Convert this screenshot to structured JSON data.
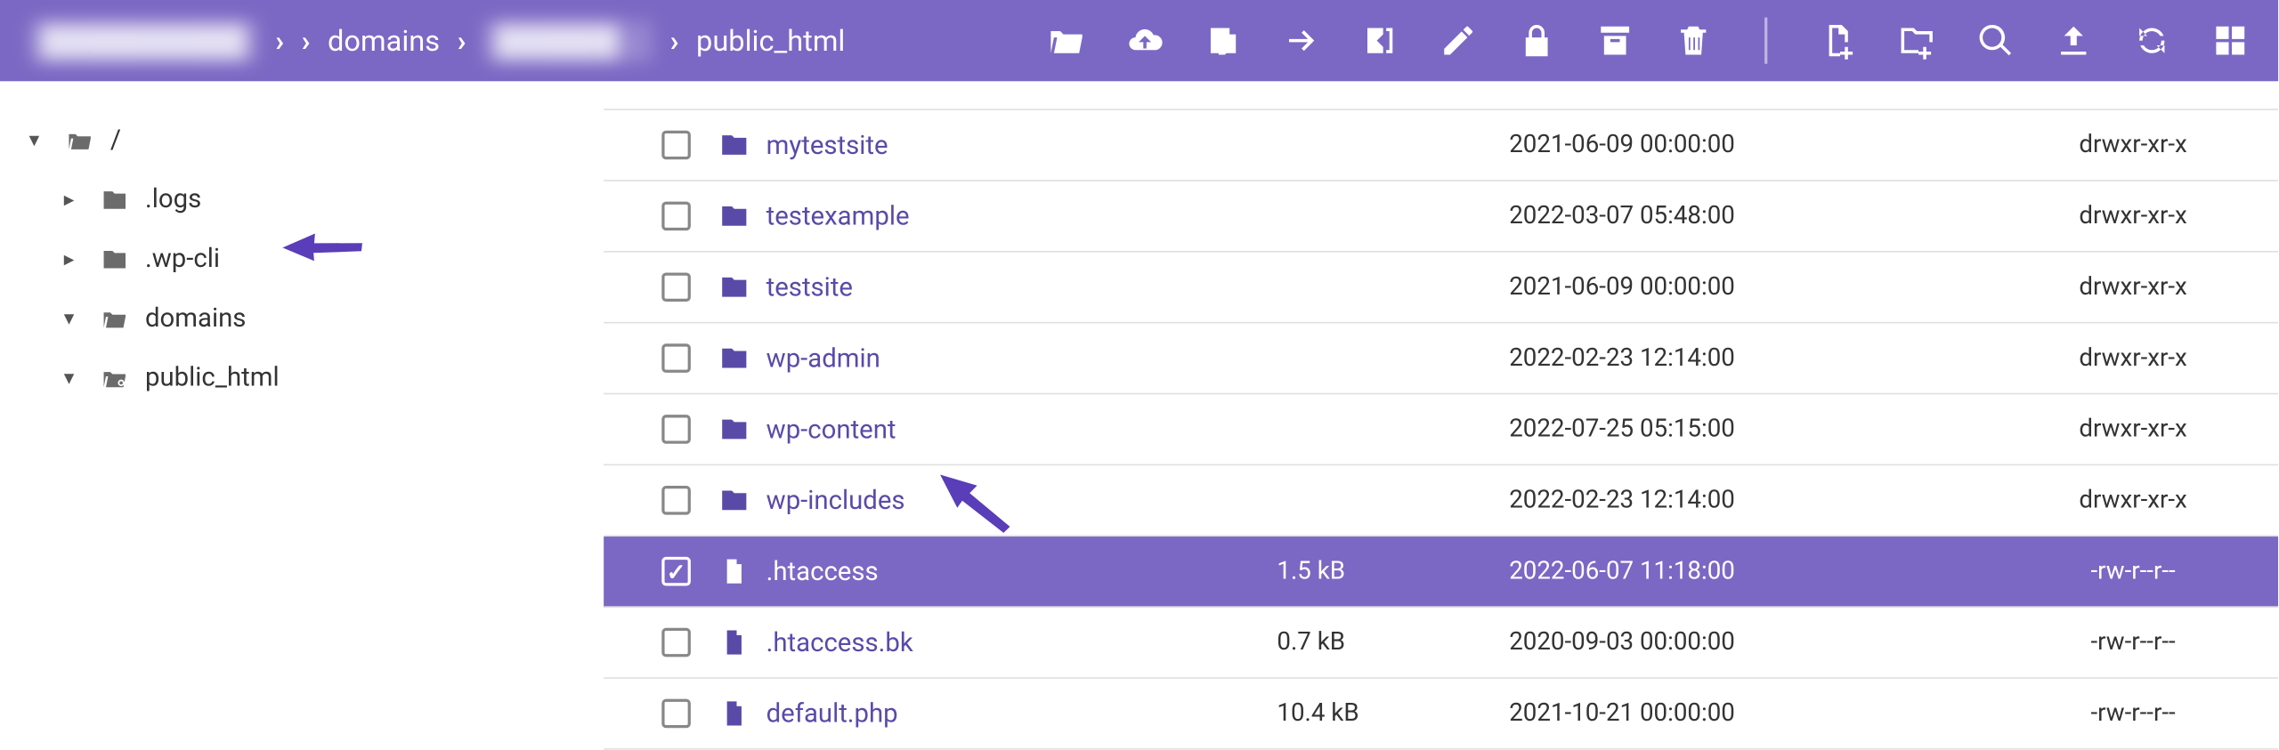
{
  "breadcrumb": {
    "host_blurred": "██████████",
    "items": [
      "domains",
      "██████ ..",
      "public_html"
    ]
  },
  "tree": [
    {
      "caret": "▾",
      "icon": "folder-open",
      "label": "/",
      "indent": 0
    },
    {
      "caret": "▸",
      "icon": "folder",
      "label": ".logs",
      "indent": 1
    },
    {
      "caret": "▸",
      "icon": "folder",
      "label": ".wp-cli",
      "indent": 1
    },
    {
      "caret": "▾",
      "icon": "folder-open",
      "label": "domains",
      "indent": 1
    },
    {
      "caret": "▾",
      "icon": "folder-link",
      "label": "public_html",
      "indent": 1,
      "annotated": true
    }
  ],
  "files": [
    {
      "type": "folder",
      "name": "mytestsite",
      "size": "",
      "date": "2021-06-09 00:00:00",
      "perm": "drwxr-xr-x",
      "selected": false
    },
    {
      "type": "folder",
      "name": "testexample",
      "size": "",
      "date": "2022-03-07 05:48:00",
      "perm": "drwxr-xr-x",
      "selected": false
    },
    {
      "type": "folder",
      "name": "testsite",
      "size": "",
      "date": "2021-06-09 00:00:00",
      "perm": "drwxr-xr-x",
      "selected": false
    },
    {
      "type": "folder",
      "name": "wp-admin",
      "size": "",
      "date": "2022-02-23 12:14:00",
      "perm": "drwxr-xr-x",
      "selected": false
    },
    {
      "type": "folder",
      "name": "wp-content",
      "size": "",
      "date": "2022-07-25 05:15:00",
      "perm": "drwxr-xr-x",
      "selected": false
    },
    {
      "type": "folder",
      "name": "wp-includes",
      "size": "",
      "date": "2022-02-23 12:14:00",
      "perm": "drwxr-xr-x",
      "selected": false,
      "annotated": true
    },
    {
      "type": "file",
      "name": ".htaccess",
      "size": "1.5 kB",
      "date": "2022-06-07 11:18:00",
      "perm": "-rw-r--r--",
      "selected": true
    },
    {
      "type": "file",
      "name": ".htaccess.bk",
      "size": "0.7 kB",
      "date": "2020-09-03 00:00:00",
      "perm": "-rw-r--r--",
      "selected": false
    },
    {
      "type": "file",
      "name": "default.php",
      "size": "10.4 kB",
      "date": "2021-10-21 00:00:00",
      "perm": "-rw-r--r--",
      "selected": false
    }
  ],
  "toolbar_icons": [
    "folder-open-icon",
    "upload-cloud-icon",
    "edit-file-icon",
    "move-icon",
    "copy-out-icon",
    "pencil-icon",
    "lock-icon",
    "archive-icon",
    "trash-icon",
    "divider",
    "new-file-icon",
    "new-folder-icon",
    "search-icon",
    "upload-icon",
    "refresh-icon",
    "grid-icon"
  ]
}
